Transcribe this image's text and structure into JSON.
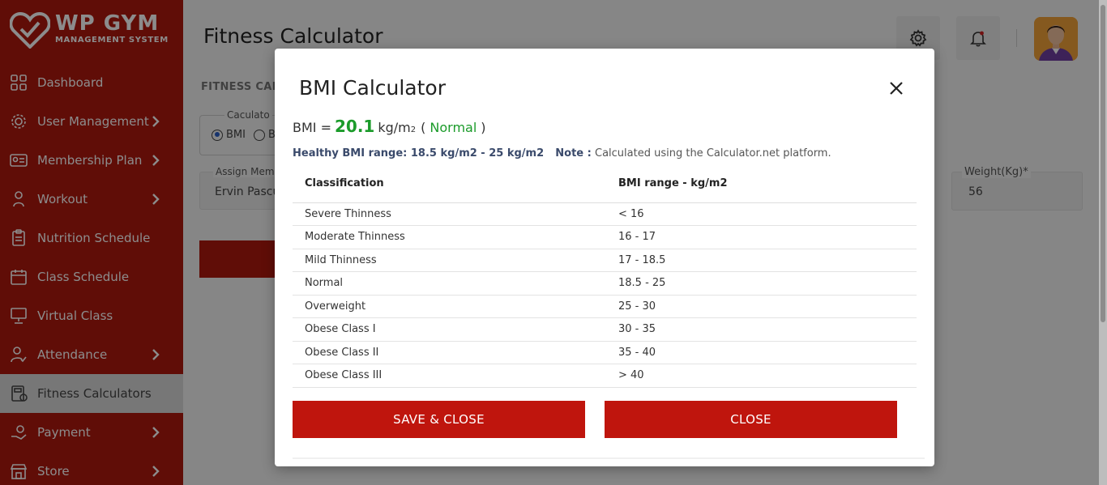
{
  "brand": {
    "title": "WP GYM",
    "subtitle": "MANAGEMENT SYSTEM"
  },
  "sidebar": {
    "items": [
      {
        "label": "Dashboard",
        "icon": "grid-icon",
        "chevron": false,
        "active": false
      },
      {
        "label": "User Management",
        "icon": "users-gear-icon",
        "chevron": true,
        "active": false
      },
      {
        "label": "Membership Plan",
        "icon": "id-card-icon",
        "chevron": true,
        "active": false
      },
      {
        "label": "Workout",
        "icon": "dumbbell-person-icon",
        "chevron": true,
        "active": false
      },
      {
        "label": "Nutrition Schedule",
        "icon": "clipboard-icon",
        "chevron": false,
        "active": false
      },
      {
        "label": "Class Schedule",
        "icon": "calendar-icon",
        "chevron": false,
        "active": false
      },
      {
        "label": "Virtual Class",
        "icon": "presentation-icon",
        "chevron": false,
        "active": false
      },
      {
        "label": "Attendance",
        "icon": "user-check-icon",
        "chevron": true,
        "active": false
      },
      {
        "label": "Fitness Calculators",
        "icon": "calculator-icon",
        "chevron": false,
        "active": true
      },
      {
        "label": "Payment",
        "icon": "hand-money-icon",
        "chevron": true,
        "active": false
      },
      {
        "label": "Store",
        "icon": "store-icon",
        "chevron": true,
        "active": false
      }
    ]
  },
  "header": {
    "title": "Fitness Calculator"
  },
  "background_form": {
    "section_label": "FITNESS CALC",
    "calculator_legend": "Caculato",
    "radio_bmi": "BMI",
    "radio_other": "B",
    "member_legend": "Assign Mem",
    "member_value": "Ervin Pascu",
    "weight_legend": "Weight(Kg)*",
    "weight_value": "56"
  },
  "modal": {
    "title": "BMI Calculator",
    "bmi_prefix": "BMI =",
    "bmi_value": "20.1",
    "bmi_unit": "kg/m",
    "bmi_unit_sup": "2",
    "bmi_status_open": "(",
    "bmi_status": "Normal",
    "bmi_status_close": ")",
    "healthy_range": "Healthy BMI range: 18.5 kg/m2 - 25 kg/m2",
    "note_label": "Note :",
    "note_text": "Calculated using the Calculator.net platform.",
    "table": {
      "headers": [
        "Classification",
        "BMI range - kg/m2"
      ],
      "rows": [
        [
          "Severe Thinness",
          "< 16"
        ],
        [
          "Moderate Thinness",
          "16 - 17"
        ],
        [
          "Mild Thinness",
          "17 - 18.5"
        ],
        [
          "Normal",
          "18.5 - 25"
        ],
        [
          "Overweight",
          "25 - 30"
        ],
        [
          "Obese Class I",
          "30 - 35"
        ],
        [
          "Obese Class II",
          "35 - 40"
        ],
        [
          "Obese Class III",
          "> 40"
        ]
      ]
    },
    "save_button": "SAVE & CLOSE",
    "close_button": "CLOSE"
  },
  "colors": {
    "brand_red": "#b0180d",
    "button_red": "#bf150d",
    "bmi_green": "#1b9b2a"
  }
}
